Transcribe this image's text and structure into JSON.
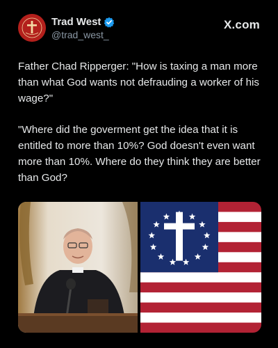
{
  "author": {
    "display_name": "Trad West",
    "handle": "@trad_west_",
    "verified": true,
    "avatar_icon": "trad-west-logo-icon",
    "avatar_lettering": "TRAD WEST"
  },
  "brand": {
    "label": "X.com"
  },
  "tweet": {
    "paragraph_1": "Father Chad Ripperger: \"How is taxing a man more than what God wants not defrauding a worker of his wage?\"",
    "paragraph_2": "\"Where did the goverment get the idea that it is entitled to more than 10%? God doesn't even want more than 10%. Where do they think they are better than God?"
  },
  "media": {
    "left": "priest-photo",
    "right": "cross-flag-image"
  },
  "colors": {
    "verified": "#1d9bf0",
    "avatar": "#b3201c",
    "flag_red": "#b22234",
    "flag_blue": "#1a2f6e",
    "handle_gray": "#8b98a5"
  }
}
